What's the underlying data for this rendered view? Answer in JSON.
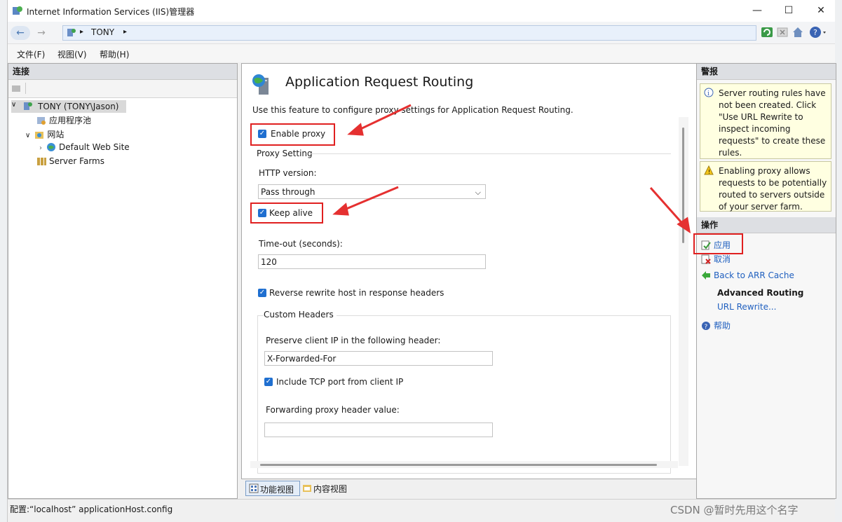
{
  "window": {
    "title": "Internet Information Services (IIS)管理器",
    "min_label": "—",
    "max_label": "☐",
    "close_label": "✕"
  },
  "address": {
    "crumb": "TONY",
    "sep": "▸"
  },
  "menu": [
    "文件(F)",
    "视图(V)",
    "帮助(H)"
  ],
  "connections": {
    "header": "连接",
    "server": "TONY (TONY\\Jason)",
    "app_pools": "应用程序池",
    "sites": "网站",
    "default_site": "Default Web Site",
    "server_farms": "Server Farms"
  },
  "feature": {
    "title": "Application Request Routing",
    "description": "Use this feature to configure proxy settings for Application Request Routing.",
    "enable_proxy": "Enable proxy",
    "proxy_setting": "Proxy Setting",
    "http_version_label": "HTTP version:",
    "http_version_value": "Pass through",
    "keep_alive": "Keep alive",
    "timeout_label": "Time-out (seconds):",
    "timeout_value": "120",
    "reverse_rewrite": "Reverse rewrite host in response headers",
    "custom_headers": "Custom Headers",
    "preserve_ip_label": "Preserve client IP in the following header:",
    "preserve_ip_value": "X-Forwarded-For",
    "include_tcp": "Include TCP port from client IP",
    "forwarding_label": "Forwarding proxy header value:",
    "forwarding_value": ""
  },
  "tabs": {
    "features_view": "功能视图",
    "content_view": "内容视图"
  },
  "alerts": {
    "header": "警报",
    "alert1": "Server routing rules have not been created. Click \"Use URL Rewrite to inspect incoming requests\" to create these rules.",
    "alert2": "Enabling proxy allows requests to be potentially routed to servers outside of your server farm."
  },
  "actions": {
    "header": "操作",
    "apply": "应用",
    "cancel": "取消",
    "back_arr": "Back to ARR Cache",
    "advanced_routing": "Advanced Routing",
    "url_rewrite": "URL Rewrite...",
    "help": "帮助"
  },
  "status": {
    "config": "配置:“localhost” applicationHost.config"
  },
  "watermark": "CSDN @暂时先用这个名字"
}
